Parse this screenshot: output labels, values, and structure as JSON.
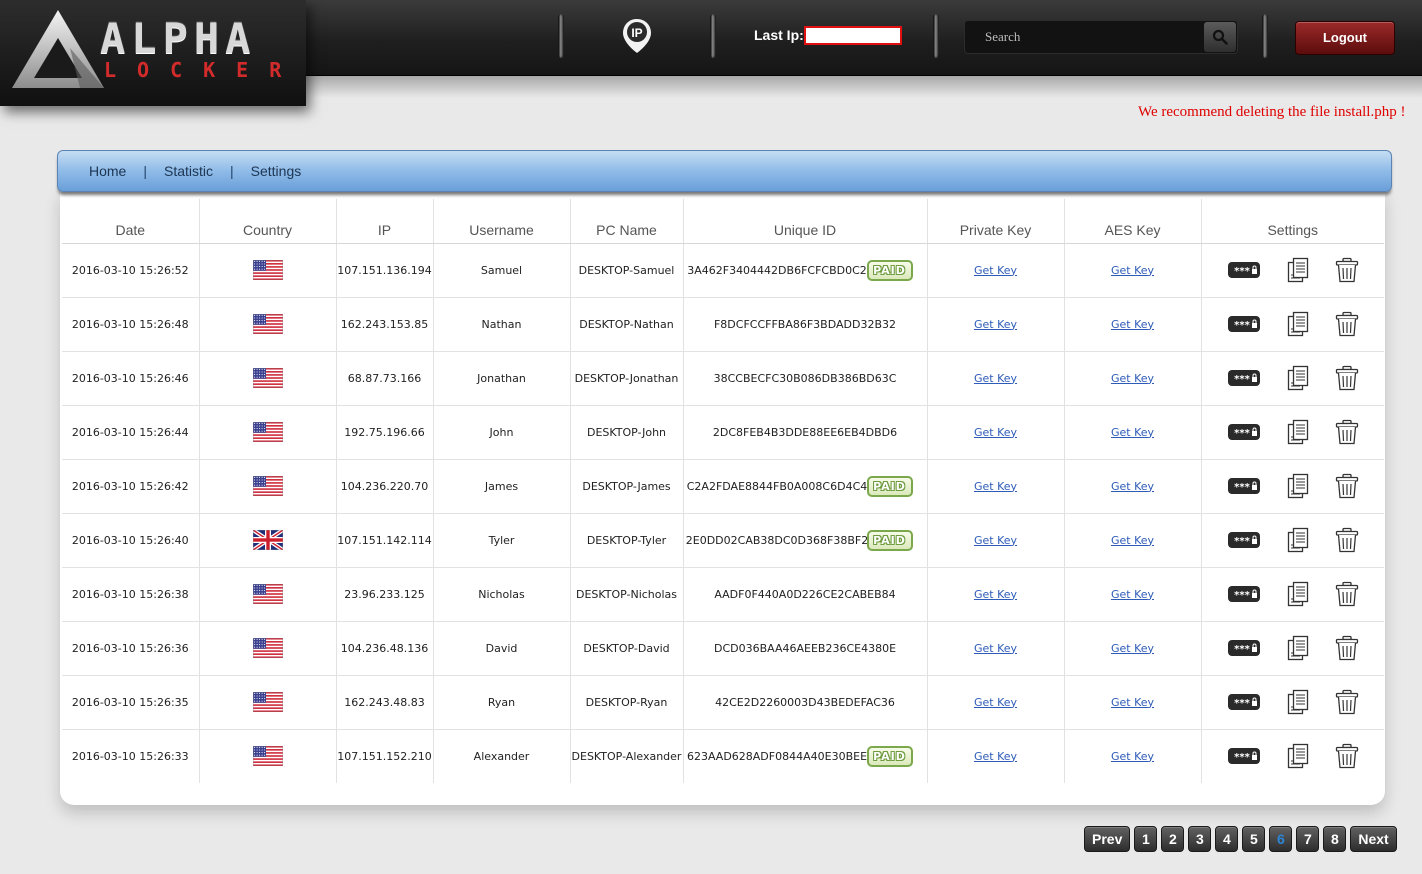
{
  "header": {
    "logo_top": "ALPHA",
    "logo_bottom": "LOCKER",
    "ip_icon": "ip-location-pin-icon",
    "last_ip_label": "Last Ip:",
    "last_ip_value": "",
    "search_placeholder": "Search",
    "search_icon": "magnifier-icon",
    "logout_label": "Logout"
  },
  "warning": "We recommend deleting the file install.php !",
  "nav": {
    "home": "Home",
    "statistic": "Statistic",
    "settings": "Settings",
    "separator": "|"
  },
  "table": {
    "columns": [
      "Date",
      "Country",
      "IP",
      "Username",
      "PC Name",
      "Unique ID",
      "Private Key",
      "AES Key",
      "Settings"
    ],
    "paid_label": "PAID",
    "get_key_label": "Get Key",
    "setting_icons": [
      "password-key-icon",
      "copy-documents-icon",
      "trash-icon"
    ],
    "rows": [
      {
        "date": "2016-03-10 15:26:52",
        "country": "us",
        "ip": "107.151.136.194",
        "username": "Samuel",
        "pc": "DESKTOP-Samuel",
        "uid": "3A462F3404442DB6FCFCBD0C2",
        "paid": true
      },
      {
        "date": "2016-03-10 15:26:48",
        "country": "us",
        "ip": "162.243.153.85",
        "username": "Nathan",
        "pc": "DESKTOP-Nathan",
        "uid": "F8DCFCCFFBA86F3BDADD32B32",
        "paid": false
      },
      {
        "date": "2016-03-10 15:26:46",
        "country": "us",
        "ip": "68.87.73.166",
        "username": "Jonathan",
        "pc": "DESKTOP-Jonathan",
        "uid": "38CCBECFC30B086DB386BD63C",
        "paid": false
      },
      {
        "date": "2016-03-10 15:26:44",
        "country": "us",
        "ip": "192.75.196.66",
        "username": "John",
        "pc": "DESKTOP-John",
        "uid": "2DC8FEB4B3DDE88EE6EB4DBD6",
        "paid": false
      },
      {
        "date": "2016-03-10 15:26:42",
        "country": "us",
        "ip": "104.236.220.70",
        "username": "James",
        "pc": "DESKTOP-James",
        "uid": "C2A2FDAE8844FB0A008C6D4C4",
        "paid": true
      },
      {
        "date": "2016-03-10 15:26:40",
        "country": "gb",
        "ip": "107.151.142.114",
        "username": "Tyler",
        "pc": "DESKTOP-Tyler",
        "uid": "2E0DD02CAB38DC0D368F38BF2",
        "paid": true
      },
      {
        "date": "2016-03-10 15:26:38",
        "country": "us",
        "ip": "23.96.233.125",
        "username": "Nicholas",
        "pc": "DESKTOP-Nicholas",
        "uid": "AADF0F440A0D226CE2CABEB84",
        "paid": false
      },
      {
        "date": "2016-03-10 15:26:36",
        "country": "us",
        "ip": "104.236.48.136",
        "username": "David",
        "pc": "DESKTOP-David",
        "uid": "DCD036BAA46AEEB236CE4380E",
        "paid": false
      },
      {
        "date": "2016-03-10 15:26:35",
        "country": "us",
        "ip": "162.243.48.83",
        "username": "Ryan",
        "pc": "DESKTOP-Ryan",
        "uid": "42CE2D2260003D43BEDEFAC36",
        "paid": false
      },
      {
        "date": "2016-03-10 15:26:33",
        "country": "us",
        "ip": "107.151.152.210",
        "username": "Alexander",
        "pc": "DESKTOP-Alexander",
        "uid": "623AAD628ADF0844A40E30BEE",
        "paid": true
      }
    ]
  },
  "pagination": {
    "prev": "Prev",
    "next": "Next",
    "pages": [
      "1",
      "2",
      "3",
      "4",
      "5",
      "6",
      "7",
      "8"
    ],
    "current": "6"
  }
}
